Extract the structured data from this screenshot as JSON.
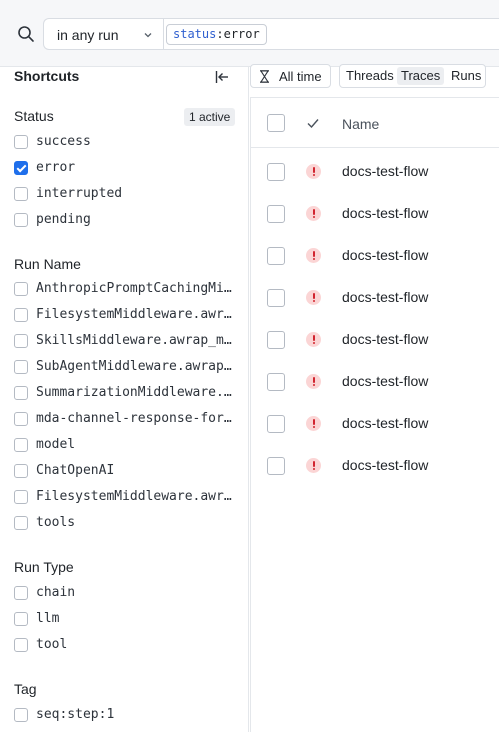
{
  "header": {
    "search_icon": "search-icon",
    "run_scope": "in any run",
    "filter": {
      "key": "status",
      "sep": ":",
      "value": "error"
    }
  },
  "sidebar": {
    "title": "Shortcuts",
    "collapse_icon": "collapse-left-icon",
    "sections": {
      "status": {
        "title": "Status",
        "badge": "1 active",
        "options": [
          {
            "label": "success",
            "checked": false
          },
          {
            "label": "error",
            "checked": true
          },
          {
            "label": "interrupted",
            "checked": false
          },
          {
            "label": "pending",
            "checked": false
          }
        ]
      },
      "run_name": {
        "title": "Run Name",
        "options": [
          {
            "label": "AnthropicPromptCachingMiddleware",
            "checked": false
          },
          {
            "label": "FilesystemMiddleware.awrap_model_call",
            "checked": false
          },
          {
            "label": "SkillsMiddleware.awrap_model_call",
            "checked": false
          },
          {
            "label": "SubAgentMiddleware.awrap_model_call",
            "checked": false
          },
          {
            "label": "SummarizationMiddleware.before_model",
            "checked": false
          },
          {
            "label": "mda-channel-response-formatter",
            "checked": false
          },
          {
            "label": "model",
            "checked": false
          },
          {
            "label": "ChatOpenAI",
            "checked": false
          },
          {
            "label": "FilesystemMiddleware.awrap_tool_call",
            "checked": false
          },
          {
            "label": "tools",
            "checked": false
          }
        ]
      },
      "run_type": {
        "title": "Run Type",
        "options": [
          {
            "label": "chain",
            "checked": false
          },
          {
            "label": "llm",
            "checked": false
          },
          {
            "label": "tool",
            "checked": false
          }
        ]
      },
      "tag": {
        "title": "Tag",
        "options": [
          {
            "label": "seq:step:1",
            "checked": false
          }
        ]
      }
    }
  },
  "toolbar": {
    "time_icon": "hourglass-icon",
    "time_range": "All time",
    "views": [
      {
        "label": "Threads",
        "active": false
      },
      {
        "label": "Traces",
        "active": true
      },
      {
        "label": "Runs",
        "active": false
      }
    ]
  },
  "table": {
    "columns": {
      "status_icon": "check-icon",
      "name": "Name"
    },
    "rows": [
      {
        "status": "error",
        "name": "docs-test-flow"
      },
      {
        "status": "error",
        "name": "docs-test-flow"
      },
      {
        "status": "error",
        "name": "docs-test-flow"
      },
      {
        "status": "error",
        "name": "docs-test-flow"
      },
      {
        "status": "error",
        "name": "docs-test-flow"
      },
      {
        "status": "error",
        "name": "docs-test-flow"
      },
      {
        "status": "error",
        "name": "docs-test-flow"
      },
      {
        "status": "error",
        "name": "docs-test-flow"
      }
    ]
  },
  "colors": {
    "accent": "#1f6feb",
    "error": "#d1242f",
    "error_bg": "#fbd5d5",
    "border": "#e4e7eb"
  }
}
